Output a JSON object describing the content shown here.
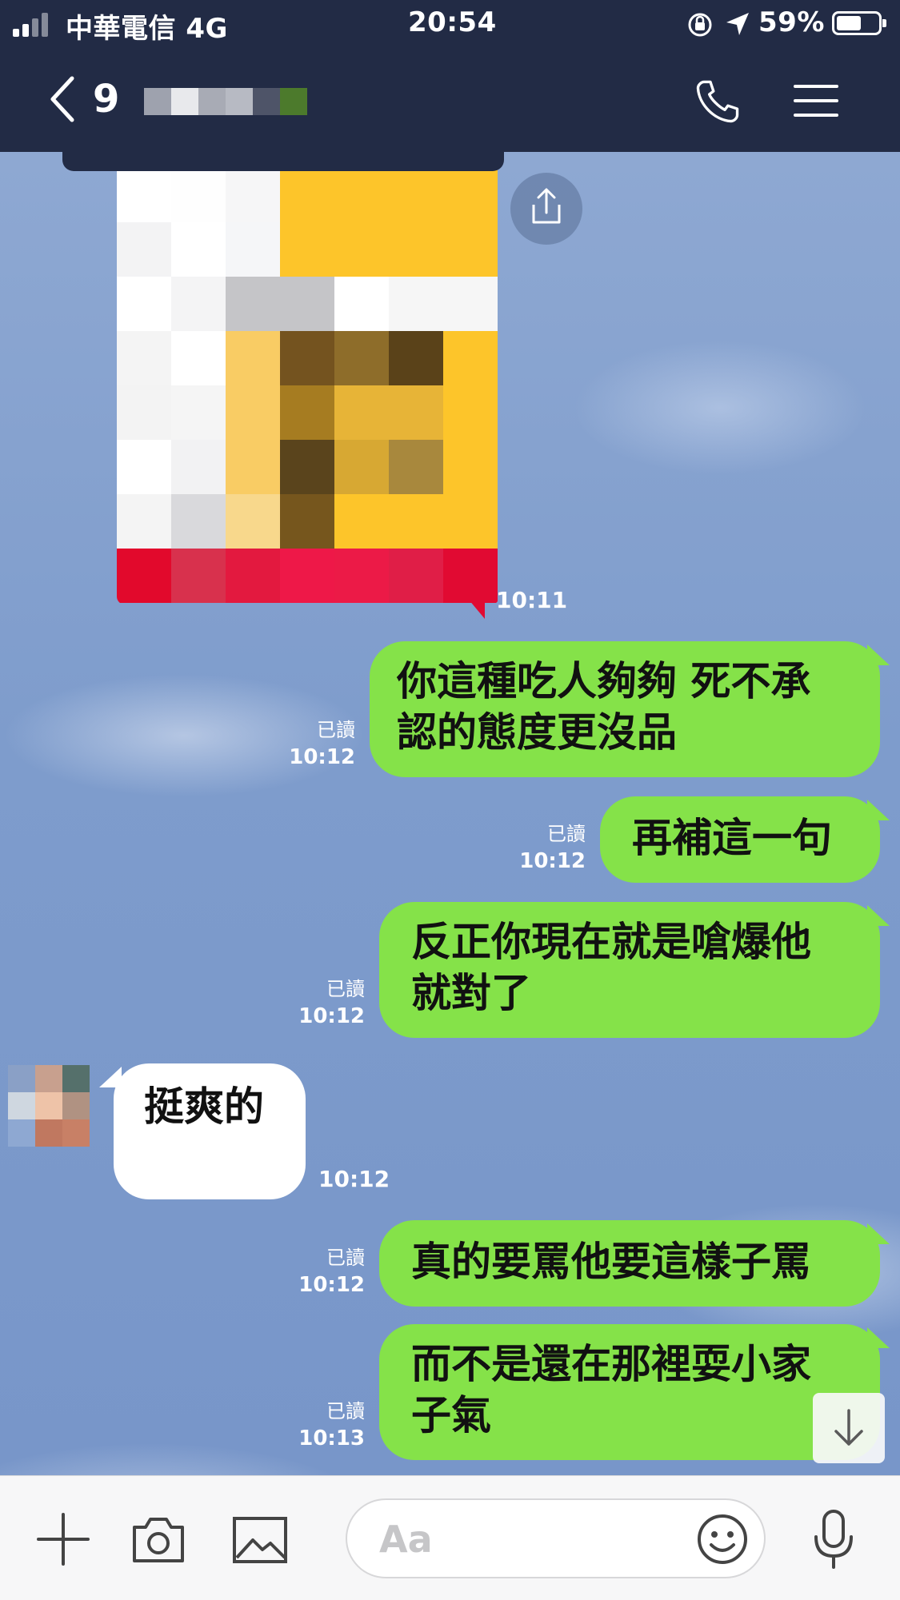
{
  "status_bar": {
    "carrier": "中華電信 4G",
    "time": "20:54",
    "battery": "59%",
    "battery_level": 0.59
  },
  "nav": {
    "back_count": "9",
    "icons": [
      "chevron-left-icon",
      "phone-icon",
      "menu-icon"
    ]
  },
  "messages": [
    {
      "side": "in",
      "type": "image",
      "time": "10:11"
    },
    {
      "side": "out",
      "lines": [
        "你這種吃人夠夠 死不承",
        "認的態度更沒品"
      ],
      "read": "已讀",
      "time": "10:12"
    },
    {
      "side": "out",
      "lines": [
        "再補這一句"
      ],
      "read": "已讀",
      "time": "10:12"
    },
    {
      "side": "out",
      "lines": [
        "反正你現在就是嗆爆他",
        "就對了"
      ],
      "read": "已讀",
      "time": "10:12"
    },
    {
      "side": "in",
      "lines": [
        "挺爽的"
      ],
      "time": "10:12"
    },
    {
      "side": "out",
      "lines": [
        "真的要罵他要這樣子罵"
      ],
      "read": "已讀",
      "time": "10:12"
    },
    {
      "side": "out",
      "lines": [
        "而不是還在那裡耍小家",
        "子氣"
      ],
      "read": "已讀",
      "time": "10:13"
    }
  ],
  "input": {
    "placeholder": "Aa",
    "icons": [
      "plus-icon",
      "camera-icon",
      "image-icon",
      "emoji-icon",
      "microphone-icon"
    ]
  },
  "colors": {
    "header": "#222b45",
    "outgoing_bubble": "#85e249",
    "incoming_bubble": "#ffffff",
    "chat_background": "#7e9ccc"
  }
}
